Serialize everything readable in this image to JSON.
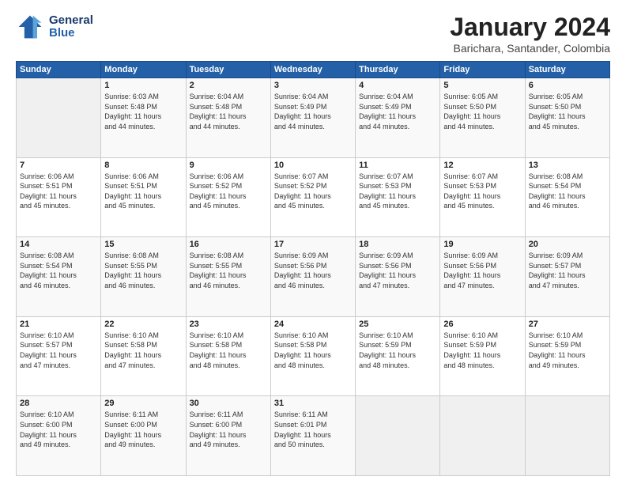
{
  "header": {
    "logo_line1": "General",
    "logo_line2": "Blue",
    "title": "January 2024",
    "location": "Barichara, Santander, Colombia"
  },
  "weekdays": [
    "Sunday",
    "Monday",
    "Tuesday",
    "Wednesday",
    "Thursday",
    "Friday",
    "Saturday"
  ],
  "weeks": [
    [
      {
        "day": "",
        "info": ""
      },
      {
        "day": "1",
        "info": "Sunrise: 6:03 AM\nSunset: 5:48 PM\nDaylight: 11 hours\nand 44 minutes."
      },
      {
        "day": "2",
        "info": "Sunrise: 6:04 AM\nSunset: 5:48 PM\nDaylight: 11 hours\nand 44 minutes."
      },
      {
        "day": "3",
        "info": "Sunrise: 6:04 AM\nSunset: 5:49 PM\nDaylight: 11 hours\nand 44 minutes."
      },
      {
        "day": "4",
        "info": "Sunrise: 6:04 AM\nSunset: 5:49 PM\nDaylight: 11 hours\nand 44 minutes."
      },
      {
        "day": "5",
        "info": "Sunrise: 6:05 AM\nSunset: 5:50 PM\nDaylight: 11 hours\nand 44 minutes."
      },
      {
        "day": "6",
        "info": "Sunrise: 6:05 AM\nSunset: 5:50 PM\nDaylight: 11 hours\nand 45 minutes."
      }
    ],
    [
      {
        "day": "7",
        "info": "Sunrise: 6:06 AM\nSunset: 5:51 PM\nDaylight: 11 hours\nand 45 minutes."
      },
      {
        "day": "8",
        "info": "Sunrise: 6:06 AM\nSunset: 5:51 PM\nDaylight: 11 hours\nand 45 minutes."
      },
      {
        "day": "9",
        "info": "Sunrise: 6:06 AM\nSunset: 5:52 PM\nDaylight: 11 hours\nand 45 minutes."
      },
      {
        "day": "10",
        "info": "Sunrise: 6:07 AM\nSunset: 5:52 PM\nDaylight: 11 hours\nand 45 minutes."
      },
      {
        "day": "11",
        "info": "Sunrise: 6:07 AM\nSunset: 5:53 PM\nDaylight: 11 hours\nand 45 minutes."
      },
      {
        "day": "12",
        "info": "Sunrise: 6:07 AM\nSunset: 5:53 PM\nDaylight: 11 hours\nand 45 minutes."
      },
      {
        "day": "13",
        "info": "Sunrise: 6:08 AM\nSunset: 5:54 PM\nDaylight: 11 hours\nand 46 minutes."
      }
    ],
    [
      {
        "day": "14",
        "info": "Sunrise: 6:08 AM\nSunset: 5:54 PM\nDaylight: 11 hours\nand 46 minutes."
      },
      {
        "day": "15",
        "info": "Sunrise: 6:08 AM\nSunset: 5:55 PM\nDaylight: 11 hours\nand 46 minutes."
      },
      {
        "day": "16",
        "info": "Sunrise: 6:08 AM\nSunset: 5:55 PM\nDaylight: 11 hours\nand 46 minutes."
      },
      {
        "day": "17",
        "info": "Sunrise: 6:09 AM\nSunset: 5:56 PM\nDaylight: 11 hours\nand 46 minutes."
      },
      {
        "day": "18",
        "info": "Sunrise: 6:09 AM\nSunset: 5:56 PM\nDaylight: 11 hours\nand 47 minutes."
      },
      {
        "day": "19",
        "info": "Sunrise: 6:09 AM\nSunset: 5:56 PM\nDaylight: 11 hours\nand 47 minutes."
      },
      {
        "day": "20",
        "info": "Sunrise: 6:09 AM\nSunset: 5:57 PM\nDaylight: 11 hours\nand 47 minutes."
      }
    ],
    [
      {
        "day": "21",
        "info": "Sunrise: 6:10 AM\nSunset: 5:57 PM\nDaylight: 11 hours\nand 47 minutes."
      },
      {
        "day": "22",
        "info": "Sunrise: 6:10 AM\nSunset: 5:58 PM\nDaylight: 11 hours\nand 47 minutes."
      },
      {
        "day": "23",
        "info": "Sunrise: 6:10 AM\nSunset: 5:58 PM\nDaylight: 11 hours\nand 48 minutes."
      },
      {
        "day": "24",
        "info": "Sunrise: 6:10 AM\nSunset: 5:58 PM\nDaylight: 11 hours\nand 48 minutes."
      },
      {
        "day": "25",
        "info": "Sunrise: 6:10 AM\nSunset: 5:59 PM\nDaylight: 11 hours\nand 48 minutes."
      },
      {
        "day": "26",
        "info": "Sunrise: 6:10 AM\nSunset: 5:59 PM\nDaylight: 11 hours\nand 48 minutes."
      },
      {
        "day": "27",
        "info": "Sunrise: 6:10 AM\nSunset: 5:59 PM\nDaylight: 11 hours\nand 49 minutes."
      }
    ],
    [
      {
        "day": "28",
        "info": "Sunrise: 6:10 AM\nSunset: 6:00 PM\nDaylight: 11 hours\nand 49 minutes."
      },
      {
        "day": "29",
        "info": "Sunrise: 6:11 AM\nSunset: 6:00 PM\nDaylight: 11 hours\nand 49 minutes."
      },
      {
        "day": "30",
        "info": "Sunrise: 6:11 AM\nSunset: 6:00 PM\nDaylight: 11 hours\nand 49 minutes."
      },
      {
        "day": "31",
        "info": "Sunrise: 6:11 AM\nSunset: 6:01 PM\nDaylight: 11 hours\nand 50 minutes."
      },
      {
        "day": "",
        "info": ""
      },
      {
        "day": "",
        "info": ""
      },
      {
        "day": "",
        "info": ""
      }
    ]
  ]
}
